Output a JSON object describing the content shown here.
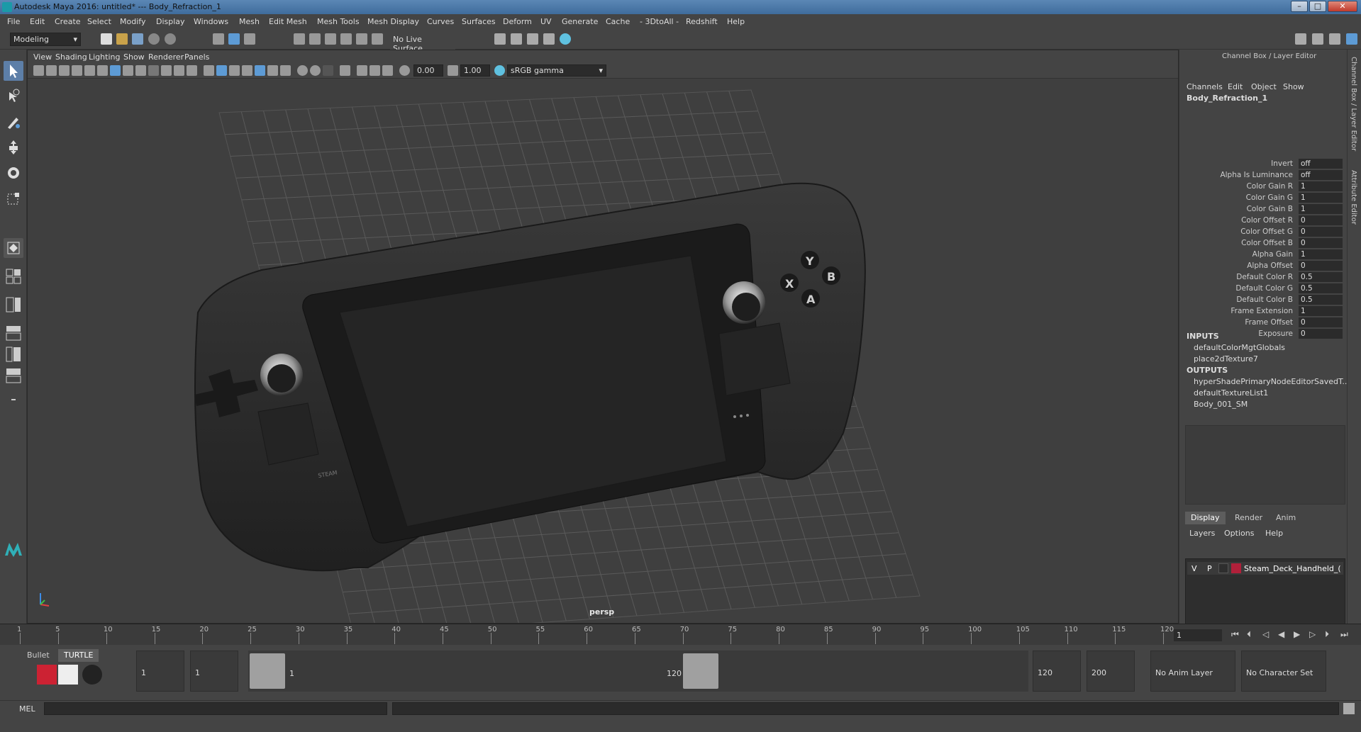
{
  "window": {
    "title": "Autodesk Maya 2016: untitled*   ---   Body_Refraction_1",
    "minimize": "–",
    "maximize": "□",
    "close": "✕"
  },
  "menubar": [
    "File",
    "Edit",
    "Create",
    "Select",
    "Modify",
    "Display",
    "Windows",
    "Mesh",
    "Edit Mesh",
    "Mesh Tools",
    "Mesh Display",
    "Curves",
    "Surfaces",
    "Deform",
    "UV",
    "Generate",
    "Cache",
    "- 3DtoAll -",
    "Redshift",
    "Help"
  ],
  "statusline": {
    "mode": "Modeling",
    "live_surface": "No Live Surface"
  },
  "viewport": {
    "menu": [
      "View",
      "Shading",
      "Lighting",
      "Show",
      "Renderer",
      "Panels"
    ],
    "exposure": "0.00",
    "gamma": "1.00",
    "color_space": "sRGB gamma",
    "camera": "persp",
    "buttons_text": {
      "y": "Y",
      "x": "X",
      "b": "B",
      "a": "A",
      "steam": "STEAM"
    }
  },
  "channelbox": {
    "header": "Channel Box / Layer Editor",
    "menu": [
      "Channels",
      "Edit",
      "Object",
      "Show"
    ],
    "node": "Body_Refraction_1",
    "attributes": [
      {
        "label": "Invert",
        "value": "off"
      },
      {
        "label": "Alpha Is Luminance",
        "value": "off"
      },
      {
        "label": "Color Gain R",
        "value": "1"
      },
      {
        "label": "Color Gain G",
        "value": "1"
      },
      {
        "label": "Color Gain B",
        "value": "1"
      },
      {
        "label": "Color Offset R",
        "value": "0"
      },
      {
        "label": "Color Offset G",
        "value": "0"
      },
      {
        "label": "Color Offset B",
        "value": "0"
      },
      {
        "label": "Alpha Gain",
        "value": "1"
      },
      {
        "label": "Alpha Offset",
        "value": "0"
      },
      {
        "label": "Default Color R",
        "value": "0.5"
      },
      {
        "label": "Default Color G",
        "value": "0.5"
      },
      {
        "label": "Default Color B",
        "value": "0.5"
      },
      {
        "label": "Frame Extension",
        "value": "1"
      },
      {
        "label": "Frame Offset",
        "value": "0"
      },
      {
        "label": "Exposure",
        "value": "0"
      }
    ],
    "inputs_label": "INPUTS",
    "inputs": [
      "defaultColorMgtGlobals",
      "place2dTexture7"
    ],
    "outputs_label": "OUTPUTS",
    "outputs": [
      "hyperShadePrimaryNodeEditorSavedT...",
      "defaultTextureList1",
      "Body_001_SM"
    ],
    "layer_tabs": [
      "Display",
      "Render",
      "Anim"
    ],
    "layer_menu": [
      "Layers",
      "Options",
      "Help"
    ],
    "layer": {
      "v": "V",
      "p": "P",
      "name": "Steam_Deck_Handheld_(",
      "color": "#b0203a"
    },
    "side_tabs": [
      "Channel Box / Layer Editor",
      "Attribute Editor"
    ]
  },
  "timeline": {
    "ticks": [
      "1",
      "5",
      "10",
      "15",
      "20",
      "25",
      "30",
      "35",
      "40",
      "45",
      "50",
      "55",
      "60",
      "65",
      "70",
      "75",
      "80",
      "85",
      "90",
      "95",
      "100",
      "105",
      "110",
      "115",
      "120"
    ],
    "current_frame": "1"
  },
  "range": {
    "shelf_tabs": [
      "Bullet",
      "TURTLE"
    ],
    "start": "1",
    "playback_start": "1",
    "range_start_label": "1",
    "range_end_label": "120",
    "playback_end": "120",
    "end": "200",
    "anim_layer": "No Anim Layer",
    "character_set": "No Character Set"
  },
  "cmdline": {
    "label": "MEL"
  },
  "colors": {
    "accent": "#5d9bd5",
    "device": "#2a2a2a",
    "layer_color": "#b0203a"
  }
}
